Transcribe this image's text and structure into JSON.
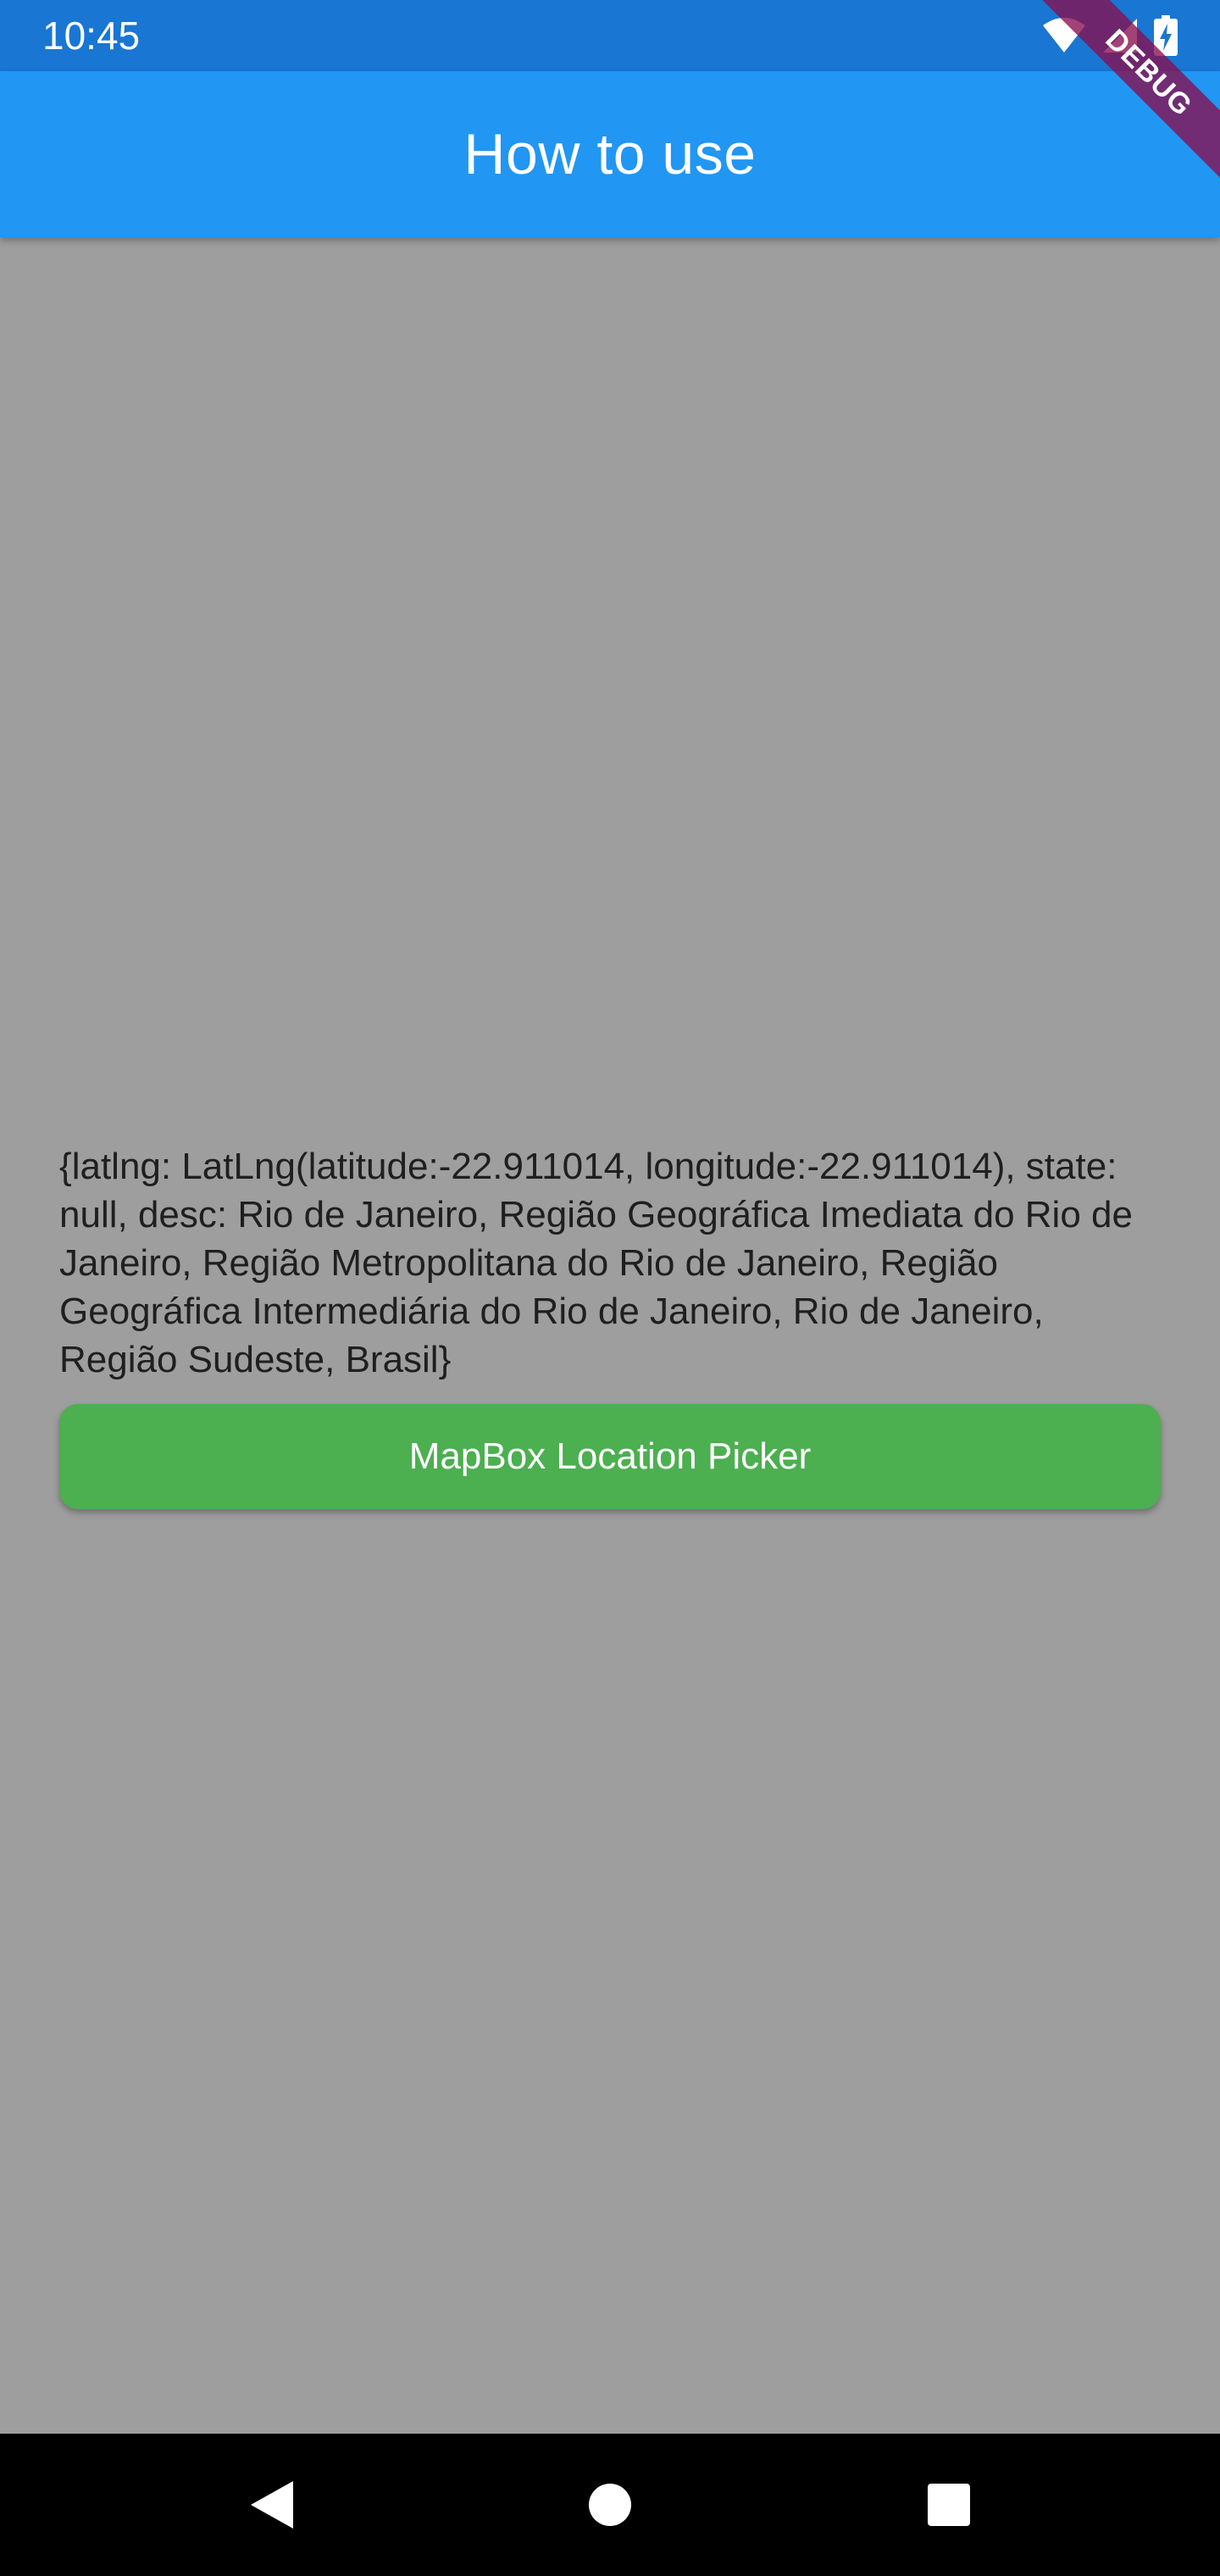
{
  "status_bar": {
    "time": "10:45",
    "icons": [
      "wifi-icon",
      "cell-signal-icon",
      "battery-charging-icon"
    ]
  },
  "app_bar": {
    "title": "How to use"
  },
  "debug_banner": {
    "label": "DEBUG"
  },
  "main": {
    "result_text": "{latlng: LatLng(latitude:-22.911014, longitude:-22.911014), state: null, desc: Rio de Janeiro, Região Geográfica Imediata do Rio de Janeiro, Região Metropolitana do Rio de Janeiro, Região Geográfica Intermediária do Rio de Janeiro, Rio de Janeiro, Região Sudeste, Brasil}",
    "picker_button_label": "MapBox Location Picker"
  },
  "nav_bar": {
    "icons": [
      "back-icon",
      "home-icon",
      "recents-icon"
    ]
  },
  "colors": {
    "status_bar": "#1976d2",
    "app_bar": "#2196f3",
    "background": "#9e9e9e",
    "button": "#4caf50",
    "debug_banner": "#880e4f",
    "nav_bar": "#000000"
  }
}
